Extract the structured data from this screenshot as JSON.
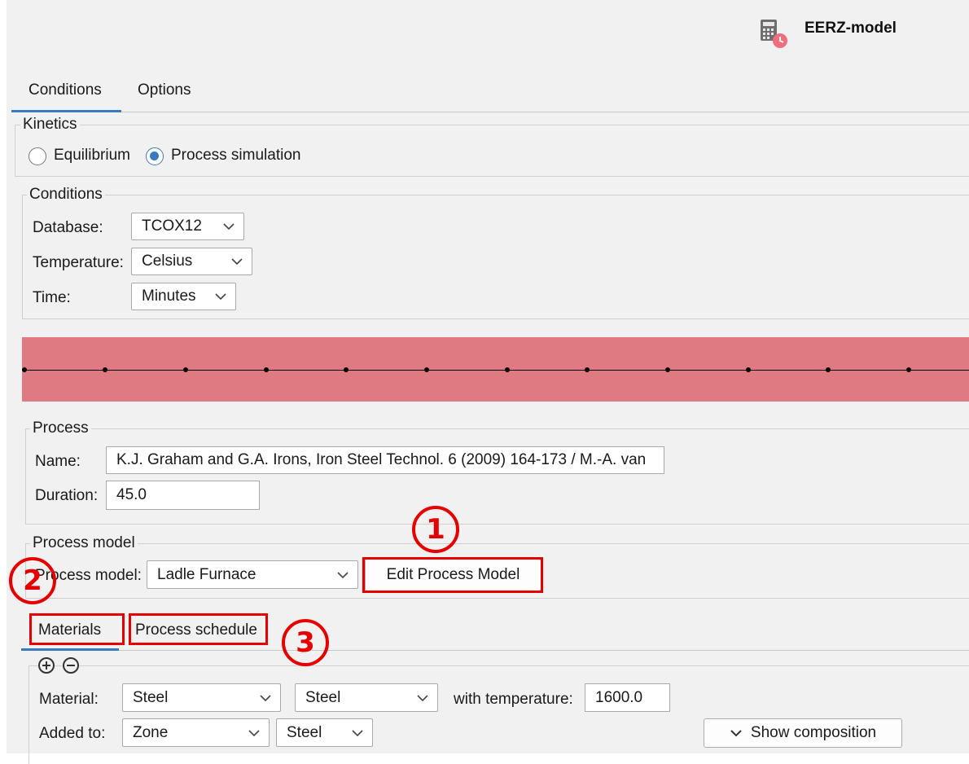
{
  "header": {
    "title": "EERZ-model",
    "icon": "calculator-clock-icon"
  },
  "tabs": [
    {
      "label": "Conditions",
      "active": true
    },
    {
      "label": "Options",
      "active": false
    }
  ],
  "kinetics": {
    "legend": "Kinetics",
    "options": [
      {
        "label": "Equilibrium",
        "selected": false
      },
      {
        "label": "Process simulation",
        "selected": true
      }
    ]
  },
  "conditions": {
    "legend": "Conditions",
    "database_label": "Database:",
    "database_value": "TCOX12",
    "temperature_label": "Temperature:",
    "temperature_value": "Celsius",
    "time_label": "Time:",
    "time_value": "Minutes"
  },
  "timeline": {
    "color": "#e07a82"
  },
  "process": {
    "legend": "Process",
    "name_label": "Name:",
    "name_value": "K.J. Graham and G.A. Irons, Iron Steel Technol. 6 (2009) 164-173 / M.-A. van",
    "duration_label": "Duration:",
    "duration_value": "45.0"
  },
  "process_model": {
    "legend": "Process model",
    "label": "Process model:",
    "value": "Ladle Furnace",
    "edit_button": "Edit Process Model"
  },
  "subtabs": [
    {
      "label": "Materials",
      "active": true
    },
    {
      "label": "Process schedule",
      "active": false
    }
  ],
  "materials": {
    "material_label": "Material:",
    "material_value1": "Steel",
    "material_value2": "Steel",
    "with_temperature_label": "with temperature:",
    "temperature_value": "1600.0",
    "added_to_label": "Added to:",
    "added_to_value1": "Zone",
    "added_to_value2": "Steel",
    "show_composition": "Show composition"
  },
  "callouts": [
    "1",
    "2",
    "3"
  ],
  "accent_color": "#3a7bbf",
  "highlight_color": "#e60000"
}
